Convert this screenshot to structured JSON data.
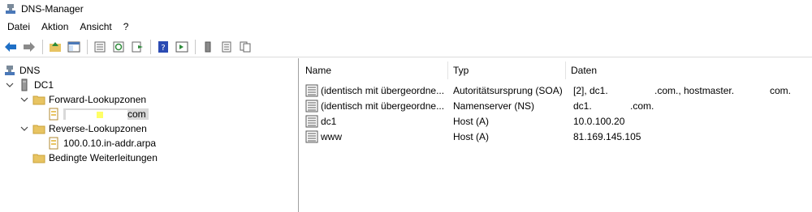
{
  "window": {
    "title": "DNS-Manager"
  },
  "menu": {
    "items": [
      "Datei",
      "Aktion",
      "Ansicht",
      "?"
    ]
  },
  "tree": {
    "root": "DNS",
    "server": "DC1",
    "forward_zones": "Forward-Lookupzonen",
    "forward_zone_selected": "com",
    "reverse_zones": "Reverse-Lookupzonen",
    "reverse_zone": "100.0.10.in-addr.arpa",
    "conditional_forwarders": "Bedingte Weiterleitungen"
  },
  "list": {
    "columns": [
      "Name",
      "Typ",
      "Daten"
    ],
    "rows": [
      {
        "name": "(identisch mit übergeordne...",
        "type": "Autoritätsursprung (SOA)",
        "data_a": "[2], dc1.",
        "data_b": ".com., hostmaster.",
        "data_c": "com."
      },
      {
        "name": "(identisch mit übergeordne...",
        "type": "Namenserver (NS)",
        "data_a": "dc1.",
        "data_b": ".com.",
        "data_c": ""
      },
      {
        "name": "dc1",
        "type": "Host (A)",
        "data_a": "10.0.100.20",
        "data_b": "",
        "data_c": ""
      },
      {
        "name": "www",
        "type": "Host (A)",
        "data_a": "81.169.145.105",
        "data_b": "",
        "data_c": ""
      }
    ]
  },
  "colors": {
    "folder": "#e8c462",
    "selected_bg": "#d9d9d9",
    "nav_arrow": "#1f6fc5",
    "help": "#2b4bb3"
  }
}
